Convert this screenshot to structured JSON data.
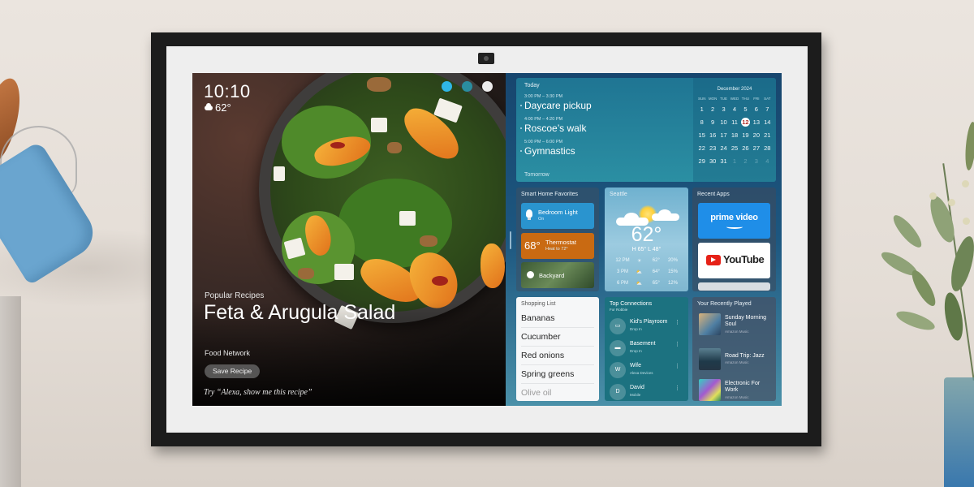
{
  "device": {
    "status_icons": [
      "notification-icon",
      "profile-icon",
      "settings-icon"
    ]
  },
  "clock": {
    "time": "10:10",
    "weather_icon": "cloud-icon",
    "temperature": "62°"
  },
  "recipe": {
    "category": "Popular Recipes",
    "title": "Feta & Arugula Salad",
    "source": "Food Network",
    "save_label": "Save Recipe",
    "voice_hint": "Try “Alexa, show me this recipe”"
  },
  "calendar": {
    "today_label": "Today",
    "events": [
      {
        "time": "3:00 PM – 3:30 PM",
        "name": "Daycare pickup"
      },
      {
        "time": "4:00 PM – 4:20 PM",
        "name": "Roscoe’s walk"
      },
      {
        "time": "5:00 PM – 6:00 PM",
        "name": "Gymnastics"
      }
    ],
    "tomorrow_label": "Tomorrow",
    "month_title": "December 2024",
    "weekdays": [
      "SUN",
      "MON",
      "TUE",
      "WED",
      "THU",
      "FRI",
      "SAT"
    ],
    "weeks": [
      [
        "1",
        "2",
        "3",
        "4",
        "5",
        "6",
        "7"
      ],
      [
        "8",
        "9",
        "10",
        "11",
        "12",
        "13",
        "14"
      ],
      [
        "15",
        "16",
        "17",
        "18",
        "19",
        "20",
        "21"
      ],
      [
        "22",
        "23",
        "24",
        "25",
        "26",
        "27",
        "28"
      ],
      [
        "29",
        "30",
        "31",
        "1",
        "2",
        "3",
        "4"
      ]
    ],
    "today_day": "12",
    "accent_color": "#b0302a"
  },
  "smart_home": {
    "title": "Smart Home Favorites",
    "light": {
      "name": "Bedroom Light",
      "state": "On",
      "icon": "lightbulb-icon"
    },
    "thermostat": {
      "value": "68°",
      "name": "Thermostat",
      "state": "Heat to 72°"
    },
    "camera": {
      "name": "Backyard",
      "icon": "camera-icon"
    }
  },
  "weather": {
    "city": "Seattle",
    "current": "62°",
    "high_low": "H 65°  L 48°",
    "forecast": [
      {
        "time": "12 PM",
        "icon": "sun-icon",
        "temp": "62°",
        "precip": "20%"
      },
      {
        "time": "3 PM",
        "icon": "partly-cloudy-icon",
        "temp": "64°",
        "precip": "15%"
      },
      {
        "time": "6 PM",
        "icon": "partly-cloudy-icon",
        "temp": "65°",
        "precip": "12%"
      }
    ]
  },
  "recent_apps": {
    "title": "Recent Apps",
    "apps": [
      "prime video",
      "YouTube"
    ]
  },
  "shopping_list": {
    "title": "Shopping List",
    "items": [
      "Bananas",
      "Cucumber",
      "Red onions",
      "Spring greens",
      "Olive oil"
    ]
  },
  "top_connections": {
    "title": "Top Connections",
    "subtitle": "For Robbie",
    "contacts": [
      {
        "avatar": "tv-icon",
        "name": "Kid's Playroom",
        "detail": "Drop In"
      },
      {
        "avatar": "echo-icon",
        "name": "Basement",
        "detail": "Drop In"
      },
      {
        "avatar": "W",
        "name": "Wife",
        "detail": "Alexa Devices"
      },
      {
        "avatar": "D",
        "name": "David",
        "detail": "Mobile"
      }
    ]
  },
  "recently_played": {
    "title": "Your Recently Played",
    "items": [
      {
        "name": "Sunday Morning Soul",
        "source": "Amazon Music"
      },
      {
        "name": "Road Trip: Jazz",
        "source": "Amazon Music"
      },
      {
        "name": "Electronic For Work",
        "source": "Amazon Music"
      }
    ]
  }
}
